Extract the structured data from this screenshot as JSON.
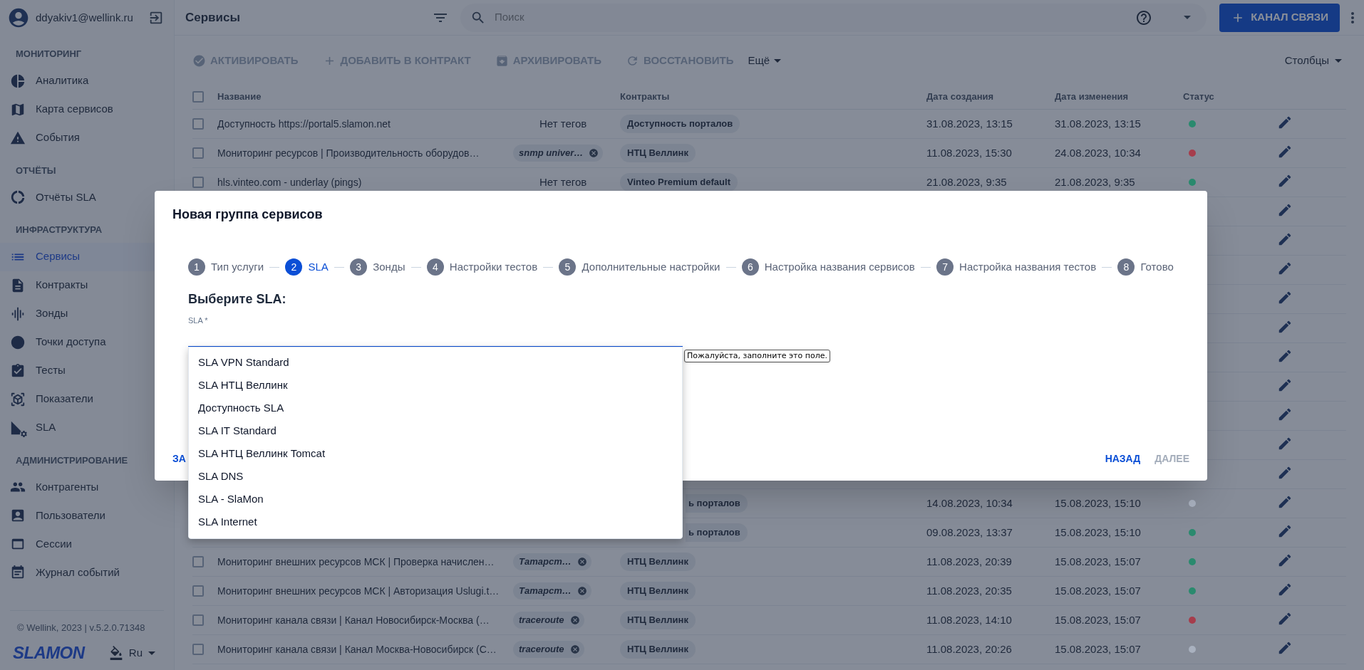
{
  "sidebar": {
    "user": {
      "email": "ddyakiv1@wellink.ru"
    },
    "sections": [
      {
        "title": "МОНИТОРИНГ",
        "items": [
          {
            "label": "Аналитика",
            "selected": false
          },
          {
            "label": "Карта сервисов",
            "selected": false
          },
          {
            "label": "События",
            "selected": false
          }
        ]
      },
      {
        "title": "ОТЧЁТЫ",
        "items": [
          {
            "label": "Отчёты SLA",
            "selected": false
          }
        ]
      },
      {
        "title": "ИНФРАСТРУКТУРА",
        "items": [
          {
            "label": "Сервисы",
            "selected": true
          },
          {
            "label": "Контракты",
            "selected": false
          },
          {
            "label": "Зонды",
            "selected": false
          },
          {
            "label": "Точки доступа",
            "selected": false
          },
          {
            "label": "Тесты",
            "selected": false
          },
          {
            "label": "Показатели",
            "selected": false
          },
          {
            "label": "SLA",
            "selected": false
          }
        ]
      },
      {
        "title": "АДМИНИСТРИРОВАНИЕ",
        "items": [
          {
            "label": "Контрагенты",
            "selected": false
          },
          {
            "label": "Пользователи",
            "selected": false
          },
          {
            "label": "Сессии",
            "selected": false
          },
          {
            "label": "Журнал событий",
            "selected": false
          }
        ]
      }
    ],
    "copyright": "© Wellink, 2023 | v.5.2.0.71348",
    "logo": "SLAMON",
    "language": "Ru"
  },
  "topbar": {
    "title": "Сервисы",
    "search": {
      "placeholder": "Поиск"
    },
    "primary_button": "КАНАЛ СВЯЗИ"
  },
  "toolbar": {
    "actions": [
      {
        "label": "АКТИВИРОВАТЬ",
        "disabled": true
      },
      {
        "label": "ДОБАВИТЬ В КОНТРАКТ",
        "disabled": true
      },
      {
        "label": "АРХИВИРОВАТЬ",
        "disabled": true
      },
      {
        "label": "ВОССТАНОВИТЬ",
        "disabled": true
      }
    ],
    "more": "Ещё",
    "columns": "Столбцы"
  },
  "table": {
    "select_all": {
      "checked": false
    },
    "columns": [
      "Название",
      "Контракты",
      "Дата создания",
      "Дата изменения",
      "Статус"
    ],
    "rows": [
      {
        "kind": "full",
        "checked": false,
        "name": "Доступность https://portal5.slamon.net",
        "tag": {
          "kind": "text",
          "label": "Нет тегов"
        },
        "contract": "Доступность порталов",
        "created": "31.08.2023, 13:15",
        "modified": "31.08.2023, 13:15",
        "color": "#2a8a6e"
      },
      {
        "kind": "full",
        "checked": false,
        "name": "Мониторинг ресурсов | Производительность оборудов…",
        "tag": {
          "kind": "chip",
          "label": "snmp univer…"
        },
        "contract": "НТЦ Веллинк",
        "created": "11.08.2023, 15:30",
        "modified": "24.08.2023, 10:34",
        "color": "#a63d4c"
      },
      {
        "kind": "full",
        "checked": false,
        "name": "hls.vinteo.com - underlay (pings)",
        "tag": {
          "kind": "text",
          "label": "Нет тегов"
        },
        "contract": "Vinteo Premium default",
        "created": "21.08.2023, 9:35",
        "modified": "21.08.2023, 9:35",
        "color": "#2a8a6e"
      },
      {
        "kind": "hidden"
      },
      {
        "kind": "hidden"
      },
      {
        "kind": "hidden"
      },
      {
        "kind": "hidden"
      },
      {
        "kind": "hidden"
      },
      {
        "kind": "hidden"
      },
      {
        "kind": "hidden"
      },
      {
        "kind": "hidden"
      },
      {
        "kind": "hidden"
      },
      {
        "kind": "hidden"
      },
      {
        "kind": "partial",
        "contract": "ь порталов",
        "created": "14.08.2023, 10:34",
        "modified": "15.08.2023, 15:10",
        "color": "#a9b1bf"
      },
      {
        "kind": "partial",
        "contract": "ь порталов",
        "created": "09.08.2023, 13:37",
        "modified": "15.08.2023, 15:10",
        "color": "#2a8a6e"
      },
      {
        "kind": "full",
        "checked": false,
        "name": "Мониторинг внешних ресурсов МСК | Проверка начислен…",
        "tag": {
          "kind": "chip",
          "label": "Татарст…"
        },
        "contract": "НТЦ Веллинк",
        "created": "11.08.2023, 20:39",
        "modified": "15.08.2023, 15:07",
        "color": "#2a8a6e"
      },
      {
        "kind": "full",
        "checked": false,
        "name": "Мониторинг внешних ресурсов МСК | Авторизация Uslugi.t…",
        "tag": {
          "kind": "chip",
          "label": "Татарст…"
        },
        "contract": "НТЦ Веллинк",
        "created": "11.08.2023, 20:35",
        "modified": "15.08.2023, 15:07",
        "color": "#2a8a6e"
      },
      {
        "kind": "full",
        "checked": false,
        "name": "Мониторинг канала связи | Канал Новосибирск-Москва (…",
        "tag": {
          "kind": "chip",
          "label": "traceroute"
        },
        "contract": "НТЦ Веллинк",
        "created": "11.08.2023, 14:10",
        "modified": "15.08.2023, 15:07",
        "color": "#a63d4c"
      },
      {
        "kind": "full",
        "checked": false,
        "name": "Мониторинг канала связи | Канал Москва-Новосибирск (С…",
        "tag": {
          "kind": "chip",
          "label": "traceroute"
        },
        "contract": "НТЦ Веллинк",
        "created": "11.08.2023, 20:26",
        "modified": "15.08.2023, 15:07",
        "color": "#a9b1bf"
      }
    ]
  },
  "dialog": {
    "title": "Новая группа сервисов",
    "steps": [
      {
        "number": "1",
        "label": "Тип услуги",
        "selected": false
      },
      {
        "number": "2",
        "label": "SLA",
        "selected": true
      },
      {
        "number": "3",
        "label": "Зонды",
        "selected": false
      },
      {
        "number": "4",
        "label": "Настройки тестов",
        "selected": false
      },
      {
        "number": "5",
        "label": "Дополнительные настройки",
        "selected": false
      },
      {
        "number": "6",
        "label": "Настройка названия сервисов",
        "selected": false
      },
      {
        "number": "7",
        "label": "Настройка названия тестов",
        "selected": false
      },
      {
        "number": "8",
        "label": "Готово",
        "selected": false
      }
    ],
    "heading": "Выберите SLA:",
    "field": {
      "label": "SLA *",
      "expanded": true,
      "options": [
        "SLA VPN Standard",
        "SLA НТЦ Веллинк",
        "Доступность SLA",
        "SLA IT Standard",
        "SLA НТЦ Веллинк Tomcat",
        "SLA DNS",
        "SLA - SlaMon",
        "SLA Internet"
      ]
    },
    "tooltip": "Пожалуйста, заполните это поле.",
    "close_button": "ЗА",
    "back_button": "НАЗАД",
    "next_button": {
      "label": "ДАЛЕЕ",
      "disabled": true
    }
  }
}
